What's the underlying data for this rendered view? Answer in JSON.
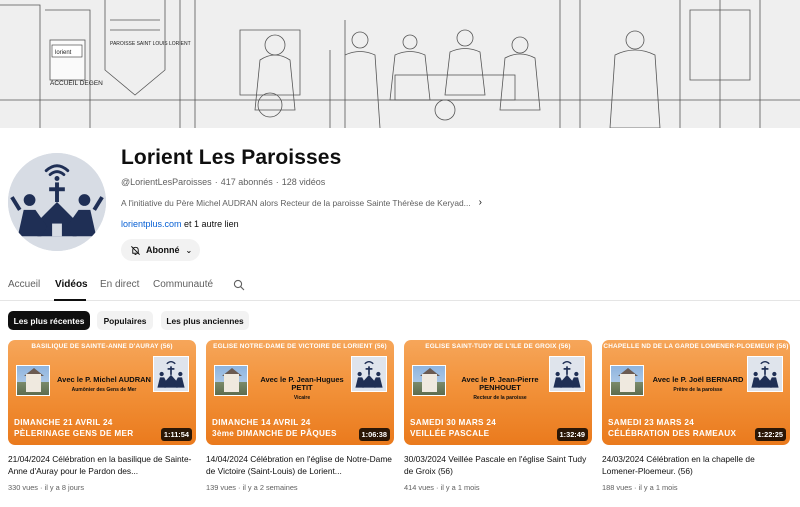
{
  "channel": {
    "title": "Lorient Les Paroisses",
    "handle": "@LorientLesParoisses",
    "subscribers": "417 abonnés",
    "videos_count": "128 vidéos",
    "description": "A l'initiative du Père Michel AUDRAN alors Recteur de la paroisse Sainte Thérèse de Keryad...",
    "link": "lorientplus.com",
    "other_links": "et 1 autre lien",
    "subscribe_label": "Abonné"
  },
  "banner": {
    "sign_left": "ACCUEIL DEGEN",
    "sign_banner": "PAROISSE SAINT LOUIS LORIENT",
    "logo_text": "lorient"
  },
  "tabs": [
    "Accueil",
    "Vidéos",
    "En direct",
    "Communauté"
  ],
  "chips": [
    "Les plus récentes",
    "Populaires",
    "Les plus anciennes"
  ],
  "videos": [
    {
      "thumb_header": "BASILIQUE DE SAINTE-ANNE D'AURAY (56)",
      "priest": "Avec le P. Michel AUDRAN",
      "role": "Aumônier des Gens de Mer",
      "line1": "DIMANCHE 21 AVRIL 24",
      "line2": "PÈLERINAGE GENS DE MER",
      "duration": "1:11:54",
      "title": "21/04/2024 Célébration en la basilique de Sainte-Anne d'Auray pour le Pardon des...",
      "views": "330 vues",
      "age": "il y a 8 jours"
    },
    {
      "thumb_header": "EGLISE NOTRE-DAME DE VICTOIRE DE LORIENT (56)",
      "priest": "Avec le P. Jean-Hugues PETIT",
      "role": "Vicaire",
      "line1": "DIMANCHE 14 AVRIL 24",
      "line2": "3ème DIMANCHE DE PÂQUES",
      "duration": "1:06:38",
      "title": "14/04/2024 Célébration en l'église de Notre-Dame de Victoire (Saint-Louis) de Lorient...",
      "views": "139 vues",
      "age": "il y a 2 semaines"
    },
    {
      "thumb_header": "EGLISE SAINT-TUDY DE L'ILE DE GROIX (56)",
      "priest": "Avec le P. Jean-Pierre PENHOUET",
      "role": "Recteur de la paroisse",
      "line1": "SAMEDI 30 MARS 24",
      "line2": "VEILLÉE PASCALE",
      "duration": "1:32:49",
      "title": "30/03/2024 Veillée Pascale en l'église Saint Tudy de Groix (56)",
      "views": "414 vues",
      "age": "il y a 1 mois"
    },
    {
      "thumb_header": "CHAPELLE ND DE LA GARDE LOMENER-PLOEMEUR (56)",
      "priest": "Avec le P. Joël BERNARD",
      "role": "Prêtre de la paroisse",
      "line1": "SAMEDI 23 MARS 24",
      "line2": "CÉLÉBRATION DES RAMEAUX",
      "duration": "1:22:25",
      "title": "24/03/2024 Célébration en la chapelle de Lomener-Ploemeur. (56)",
      "views": "188 vues",
      "age": "il y a 1 mois"
    }
  ],
  "colors": {
    "thumb_orange": "#f2923a",
    "logo_navy": "#1f2f55",
    "link_blue": "#065fd4"
  }
}
